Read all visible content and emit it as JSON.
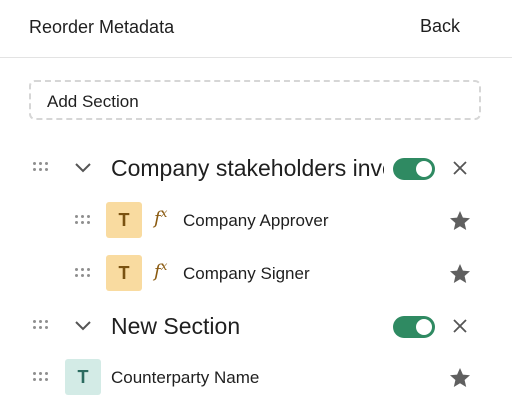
{
  "header": {
    "title": "Reorder Metadata",
    "back_label": "Back"
  },
  "add_section": {
    "label": "Add Section"
  },
  "sections": [
    {
      "title": "Company stakeholders involved",
      "enabled": true,
      "fields": [
        {
          "badge": "T",
          "formula_icon": "fx",
          "label": "Company Approver",
          "starred": true
        },
        {
          "badge": "T",
          "formula_icon": "fx",
          "label": "Company Signer",
          "starred": true
        }
      ]
    },
    {
      "title": "New Section",
      "enabled": true,
      "fields": [
        {
          "badge": "T",
          "label": "Counterparty Name",
          "starred": true
        }
      ]
    }
  ],
  "colors": {
    "toggle_on": "#2f8a62",
    "formula_badge": "#f9dba0",
    "text_badge": "#d3ebe6",
    "star": "#5f5f5f"
  }
}
